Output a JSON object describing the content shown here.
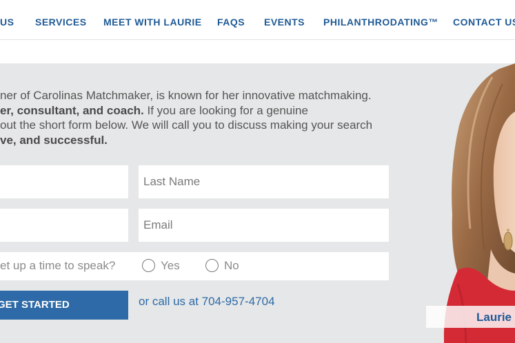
{
  "nav": {
    "items": [
      {
        "label": "US"
      },
      {
        "label": "SERVICES"
      },
      {
        "label": "MEET WITH LAURIE"
      },
      {
        "label": "FAQS"
      },
      {
        "label": "EVENTS"
      },
      {
        "label": "PHILANTHRODATING™"
      },
      {
        "label": "CONTACT US"
      }
    ]
  },
  "intro": {
    "line1": "ner of Carolinas Matchmaker, is known for her innovative matchmaking.",
    "line2_bold": "er, consultant, and coach.",
    "line2_rest": " If you are looking for a genuine",
    "line3": "out the short form below. We will call you to discuss making your search",
    "line4_bold": "ve, and successful."
  },
  "form": {
    "first_name_placeholder": "",
    "last_name_placeholder": "Last Name",
    "phone_placeholder": "",
    "email_placeholder": "Email",
    "question": "et up a time to speak?",
    "yes_label": "Yes",
    "no_label": "No",
    "submit_label": "GET STARTED",
    "call_text": "or call us at 704-957-4704"
  },
  "photo": {
    "name_tag": "Laurie"
  },
  "colors": {
    "brand_blue": "#1e5a96",
    "button_blue": "#2d6aa7",
    "hero_bg": "#e6e7e8",
    "dress_red": "#d42a35"
  }
}
